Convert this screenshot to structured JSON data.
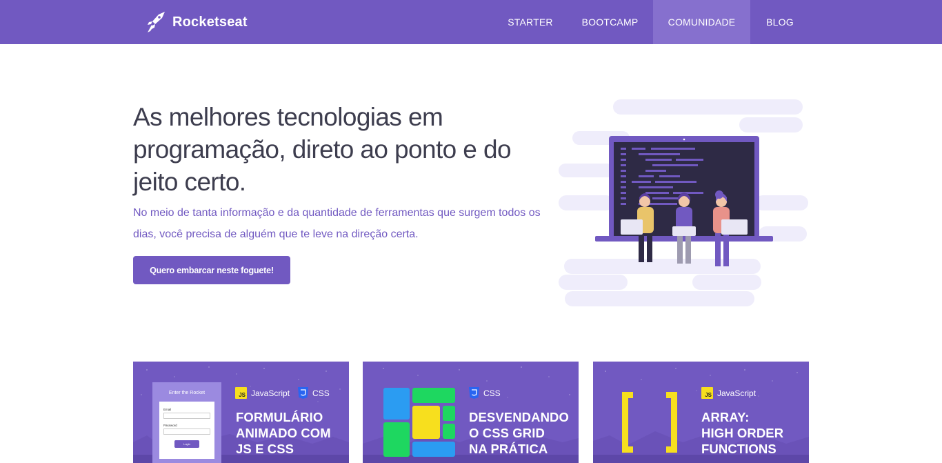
{
  "header": {
    "brand": "Rocketseat",
    "nav": [
      {
        "label": "STARTER",
        "active": false
      },
      {
        "label": "BOOTCAMP",
        "active": false
      },
      {
        "label": "COMUNIDADE",
        "active": true
      },
      {
        "label": "BLOG",
        "active": false
      }
    ]
  },
  "hero": {
    "title": "As melhores tecnologias em programação, direto ao ponto e do jeito certo.",
    "description": "No meio de tanta informação e da quantidade de ferramentas que surgem todos os dias, você precisa de alguém que te leve na direção certa.",
    "cta_label": "Quero embarcar neste foguete!"
  },
  "cards": [
    {
      "tags": [
        "JavaScript",
        "CSS"
      ],
      "title": "FORMULÁRIO\nANIMADO COM\nJS E CSS",
      "form": {
        "title": "Enter the Rocket",
        "email_label": "Email",
        "password_label": "Password",
        "button_label": "Login"
      }
    },
    {
      "tags": [
        "CSS"
      ],
      "title": "DESVENDANDO\nO CSS GRID\nNA PRÁTICA"
    },
    {
      "tags": [
        "JavaScript"
      ],
      "title": "ARRAY:\nHIGH ORDER\nFUNCTIONS"
    }
  ],
  "colors": {
    "brand": "#7159c1",
    "nav_active": "#8670ce",
    "js_yellow": "#f7df1e",
    "css_blue": "#2965f1",
    "grid_blue": "#2b9cf2",
    "grid_green": "#1ed760",
    "grid_yellow": "#f7df1e"
  },
  "icons": {
    "logo": "rocket-icon",
    "js": "javascript-badge-icon",
    "css": "css3-shield-icon"
  }
}
